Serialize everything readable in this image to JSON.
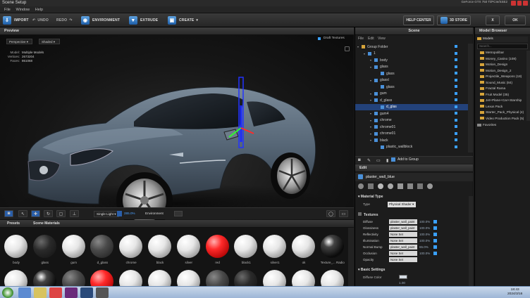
{
  "window": {
    "title": "Scene Setup",
    "gpu_line1": "GeForce GTX 750 Ti/PCIe/SSE2",
    "gpu_line2": "NVIDIA Corp"
  },
  "menu": [
    "File",
    "Window",
    "Help"
  ],
  "toolbar": {
    "import": "IMPORT",
    "undo": "UNDO",
    "redo": "REDO",
    "environment": "ENVIRONMENT",
    "extrude": "EXTRUDE",
    "create": "CREATE",
    "help_center": "HELP CENTER",
    "store": "3D STORE",
    "close": "X",
    "ok": "OK"
  },
  "preview": {
    "header": "Preview",
    "view_mode": "Perspective",
    "shading": "Shaded",
    "stats": {
      "model_label": "Model:",
      "model": "Multiple Models",
      "vertices_label": "Vertices:",
      "vertices": "2673204",
      "faces_label": "Faces:",
      "faces": "861068"
    },
    "draft_textures": "Draft Textures",
    "light": "Single Light",
    "zoom": "285.0%",
    "environment": "Environment"
  },
  "materials": {
    "tabs": [
      "Presets",
      "Scene Materials"
    ],
    "items": [
      {
        "label": "body",
        "kind": "white"
      },
      {
        "label": "glass",
        "kind": "black"
      },
      {
        "label": "gum",
        "kind": "white"
      },
      {
        "label": "d_glass",
        "kind": "dark"
      },
      {
        "label": "chrome",
        "kind": "white"
      },
      {
        "label": "black",
        "kind": "white"
      },
      {
        "label": "silver",
        "kind": "white"
      },
      {
        "label": "red",
        "kind": "red"
      },
      {
        "label": "black1",
        "kind": "white"
      },
      {
        "label": "silver1",
        "kind": "white"
      },
      {
        "label": "ok",
        "kind": "white"
      },
      {
        "label": "Texture_... Radio",
        "kind": "blackshiny"
      }
    ]
  },
  "scene": {
    "header": "Scene",
    "menu": [
      "File",
      "Edit",
      "View"
    ],
    "tree": [
      {
        "label": "Group Folder",
        "level": 0,
        "selected": false
      },
      {
        "label": "1",
        "level": 1,
        "selected": false
      },
      {
        "label": "body",
        "level": 2,
        "selected": false
      },
      {
        "label": "glass",
        "level": 2,
        "selected": false
      },
      {
        "label": "glass",
        "level": 3,
        "selected": false
      },
      {
        "label": "glassl",
        "level": 2,
        "selected": false
      },
      {
        "label": "glass",
        "level": 3,
        "selected": false
      },
      {
        "label": "gum",
        "level": 2,
        "selected": false
      },
      {
        "label": "d_glass",
        "level": 2,
        "selected": false
      },
      {
        "label": "d_glas",
        "level": 3,
        "selected": true
      },
      {
        "label": "gum4",
        "level": 2,
        "selected": false
      },
      {
        "label": "chrome",
        "level": 2,
        "selected": false
      },
      {
        "label": "chrome01",
        "level": 2,
        "selected": false
      },
      {
        "label": "chrome01",
        "level": 2,
        "selected": false
      },
      {
        "label": "black",
        "level": 2,
        "selected": false
      },
      {
        "label": "plastic_wallblock",
        "level": 3,
        "selected": false
      }
    ],
    "add_to_group": "Add to Group"
  },
  "edit": {
    "header": "Edit",
    "material_name": "plaster_wall_blue",
    "material_type_title": "Material Type",
    "type_label": "Type",
    "type_value": "Physical Shader",
    "textures_title": "Textures",
    "textures": [
      {
        "name": "Diffuse",
        "map": "plaster_wall_paint",
        "value": "100.0%",
        "swatch": true
      },
      {
        "name": "Glossiness",
        "map": "plaster_wall_paint",
        "value": "100.0%",
        "swatch": true
      },
      {
        "name": "Reflectivity",
        "map": "None Set",
        "value": "100.0%",
        "swatch": true
      },
      {
        "name": "Illumination",
        "map": "None Set",
        "value": "100.0%",
        "swatch": true
      },
      {
        "name": "Normal Bump",
        "map": "plaster_wall_paint",
        "value": "65.0%",
        "swatch": true
      },
      {
        "name": "Occlusion",
        "map": "None Set",
        "value": "100.0%",
        "swatch": true
      },
      {
        "name": "Opacity",
        "map": "None Set",
        "value": "",
        "swatch": false
      }
    ],
    "basic_title": "Basic Settings",
    "diffuse_color_label": "Diffuse Color",
    "basic_value": "1.00"
  },
  "browser": {
    "header": "Model Browser",
    "root": "Models",
    "search_placeholder": "Search...",
    "items": [
      "Metropolibar",
      "Money_Casino (108)",
      "Motion_Design",
      "Motion_Design_2",
      "Projectile_Weapons (18)",
      "Sound_Music (84)",
      "Fractal Rama",
      "Fruit Model (35)",
      "Jet+Plane+Car+Starship",
      "Lexus Pack",
      "Starter_Pack_Physical (4)",
      "Video Production Pack (5)"
    ],
    "favorites": "Favorites"
  },
  "taskbar": {
    "time": "18:43",
    "date": "2024/3/16"
  },
  "colors": {
    "accent": "#2f6fc0",
    "selection": "#23427a",
    "checkbox": "#3aa0ff"
  }
}
